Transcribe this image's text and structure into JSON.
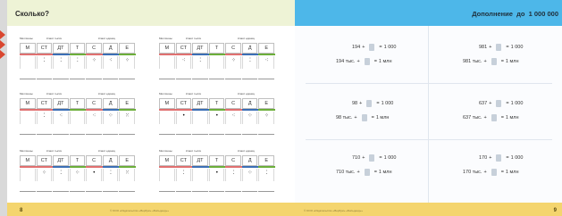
{
  "left_page": {
    "title": "Сколько?",
    "page_number": "8",
    "footer_credit": "© ООО «Издательство «Вербум» «Бильденд»»",
    "table_heads": {
      "millions": "Миллионы",
      "thousands_class": "Класс тысяч",
      "units_class": "Класс единиц"
    },
    "columns": [
      "М",
      "СТ",
      "ДТ",
      "Т",
      "С",
      "Д",
      "Е"
    ],
    "column_colors": [
      "#e07070",
      "#e07070",
      "#3b6fb5",
      "#6cae3a",
      "#e07070",
      "#3b6fb5",
      "#6cae3a"
    ],
    "tables": [
      {
        "dots": [
          "",
          "⁚",
          "⁚",
          "⁚",
          "⁘",
          "⁖",
          "⁘"
        ]
      },
      {
        "dots": [
          "",
          "⁖",
          "⁚",
          "",
          "⁘",
          "⁚",
          "⁖"
        ]
      },
      {
        "dots": [
          "",
          "⁚",
          "⁖",
          "",
          "⁖",
          "⁘",
          "⁙"
        ]
      },
      {
        "dots": [
          "",
          "•",
          "",
          "•",
          "⁖",
          "⁘",
          "⁘"
        ]
      },
      {
        "dots": [
          "",
          "⁘",
          "⁚",
          "⁘",
          "•",
          "⁚",
          "⁙"
        ]
      },
      {
        "dots": [
          "",
          "⁚",
          "",
          "•",
          "⁚",
          "⁘",
          "⁚"
        ]
      }
    ]
  },
  "right_page": {
    "title": "Дополнение  до  1 000 000",
    "page_number": "9",
    "footer_credit": "© ООО «Издательство «Вербум» «Бильденд»»",
    "exercises": [
      {
        "a": "194",
        "b": "194 тыс."
      },
      {
        "a": "981",
        "b": "981 тыс."
      },
      {
        "a": "98",
        "b": "98 тыс."
      },
      {
        "a": "637",
        "b": "637 тыс."
      },
      {
        "a": "710",
        "b": "710 тыс."
      },
      {
        "a": "170",
        "b": "170 тыс."
      }
    ],
    "plus": "+",
    "equals": "=",
    "result_thousand": "1 000",
    "result_million": "1 млн"
  }
}
